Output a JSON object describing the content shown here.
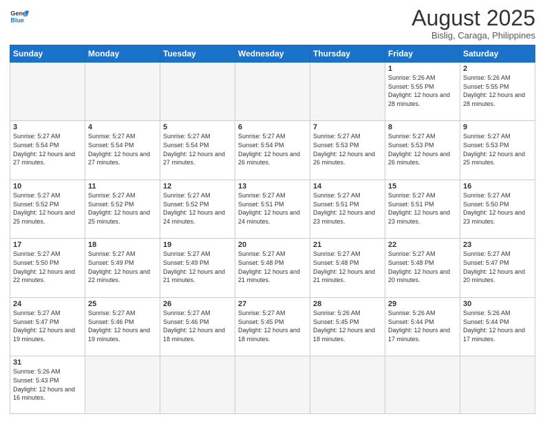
{
  "header": {
    "logo_general": "General",
    "logo_blue": "Blue",
    "month_title": "August 2025",
    "location": "Bislig, Caraga, Philippines"
  },
  "weekdays": [
    "Sunday",
    "Monday",
    "Tuesday",
    "Wednesday",
    "Thursday",
    "Friday",
    "Saturday"
  ],
  "weeks": [
    [
      {
        "day": "",
        "info": ""
      },
      {
        "day": "",
        "info": ""
      },
      {
        "day": "",
        "info": ""
      },
      {
        "day": "",
        "info": ""
      },
      {
        "day": "",
        "info": ""
      },
      {
        "day": "1",
        "info": "Sunrise: 5:26 AM\nSunset: 5:55 PM\nDaylight: 12 hours and 28 minutes."
      },
      {
        "day": "2",
        "info": "Sunrise: 5:26 AM\nSunset: 5:55 PM\nDaylight: 12 hours and 28 minutes."
      }
    ],
    [
      {
        "day": "3",
        "info": "Sunrise: 5:27 AM\nSunset: 5:54 PM\nDaylight: 12 hours and 27 minutes."
      },
      {
        "day": "4",
        "info": "Sunrise: 5:27 AM\nSunset: 5:54 PM\nDaylight: 12 hours and 27 minutes."
      },
      {
        "day": "5",
        "info": "Sunrise: 5:27 AM\nSunset: 5:54 PM\nDaylight: 12 hours and 27 minutes."
      },
      {
        "day": "6",
        "info": "Sunrise: 5:27 AM\nSunset: 5:54 PM\nDaylight: 12 hours and 26 minutes."
      },
      {
        "day": "7",
        "info": "Sunrise: 5:27 AM\nSunset: 5:53 PM\nDaylight: 12 hours and 26 minutes."
      },
      {
        "day": "8",
        "info": "Sunrise: 5:27 AM\nSunset: 5:53 PM\nDaylight: 12 hours and 26 minutes."
      },
      {
        "day": "9",
        "info": "Sunrise: 5:27 AM\nSunset: 5:53 PM\nDaylight: 12 hours and 25 minutes."
      }
    ],
    [
      {
        "day": "10",
        "info": "Sunrise: 5:27 AM\nSunset: 5:52 PM\nDaylight: 12 hours and 25 minutes."
      },
      {
        "day": "11",
        "info": "Sunrise: 5:27 AM\nSunset: 5:52 PM\nDaylight: 12 hours and 25 minutes."
      },
      {
        "day": "12",
        "info": "Sunrise: 5:27 AM\nSunset: 5:52 PM\nDaylight: 12 hours and 24 minutes."
      },
      {
        "day": "13",
        "info": "Sunrise: 5:27 AM\nSunset: 5:51 PM\nDaylight: 12 hours and 24 minutes."
      },
      {
        "day": "14",
        "info": "Sunrise: 5:27 AM\nSunset: 5:51 PM\nDaylight: 12 hours and 23 minutes."
      },
      {
        "day": "15",
        "info": "Sunrise: 5:27 AM\nSunset: 5:51 PM\nDaylight: 12 hours and 23 minutes."
      },
      {
        "day": "16",
        "info": "Sunrise: 5:27 AM\nSunset: 5:50 PM\nDaylight: 12 hours and 23 minutes."
      }
    ],
    [
      {
        "day": "17",
        "info": "Sunrise: 5:27 AM\nSunset: 5:50 PM\nDaylight: 12 hours and 22 minutes."
      },
      {
        "day": "18",
        "info": "Sunrise: 5:27 AM\nSunset: 5:49 PM\nDaylight: 12 hours and 22 minutes."
      },
      {
        "day": "19",
        "info": "Sunrise: 5:27 AM\nSunset: 5:49 PM\nDaylight: 12 hours and 21 minutes."
      },
      {
        "day": "20",
        "info": "Sunrise: 5:27 AM\nSunset: 5:48 PM\nDaylight: 12 hours and 21 minutes."
      },
      {
        "day": "21",
        "info": "Sunrise: 5:27 AM\nSunset: 5:48 PM\nDaylight: 12 hours and 21 minutes."
      },
      {
        "day": "22",
        "info": "Sunrise: 5:27 AM\nSunset: 5:48 PM\nDaylight: 12 hours and 20 minutes."
      },
      {
        "day": "23",
        "info": "Sunrise: 5:27 AM\nSunset: 5:47 PM\nDaylight: 12 hours and 20 minutes."
      }
    ],
    [
      {
        "day": "24",
        "info": "Sunrise: 5:27 AM\nSunset: 5:47 PM\nDaylight: 12 hours and 19 minutes."
      },
      {
        "day": "25",
        "info": "Sunrise: 5:27 AM\nSunset: 5:46 PM\nDaylight: 12 hours and 19 minutes."
      },
      {
        "day": "26",
        "info": "Sunrise: 5:27 AM\nSunset: 5:46 PM\nDaylight: 12 hours and 18 minutes."
      },
      {
        "day": "27",
        "info": "Sunrise: 5:27 AM\nSunset: 5:45 PM\nDaylight: 12 hours and 18 minutes."
      },
      {
        "day": "28",
        "info": "Sunrise: 5:26 AM\nSunset: 5:45 PM\nDaylight: 12 hours and 18 minutes."
      },
      {
        "day": "29",
        "info": "Sunrise: 5:26 AM\nSunset: 5:44 PM\nDaylight: 12 hours and 17 minutes."
      },
      {
        "day": "30",
        "info": "Sunrise: 5:26 AM\nSunset: 5:44 PM\nDaylight: 12 hours and 17 minutes."
      }
    ],
    [
      {
        "day": "31",
        "info": "Sunrise: 5:26 AM\nSunset: 5:43 PM\nDaylight: 12 hours and 16 minutes."
      },
      {
        "day": "",
        "info": ""
      },
      {
        "day": "",
        "info": ""
      },
      {
        "day": "",
        "info": ""
      },
      {
        "day": "",
        "info": ""
      },
      {
        "day": "",
        "info": ""
      },
      {
        "day": "",
        "info": ""
      }
    ]
  ]
}
